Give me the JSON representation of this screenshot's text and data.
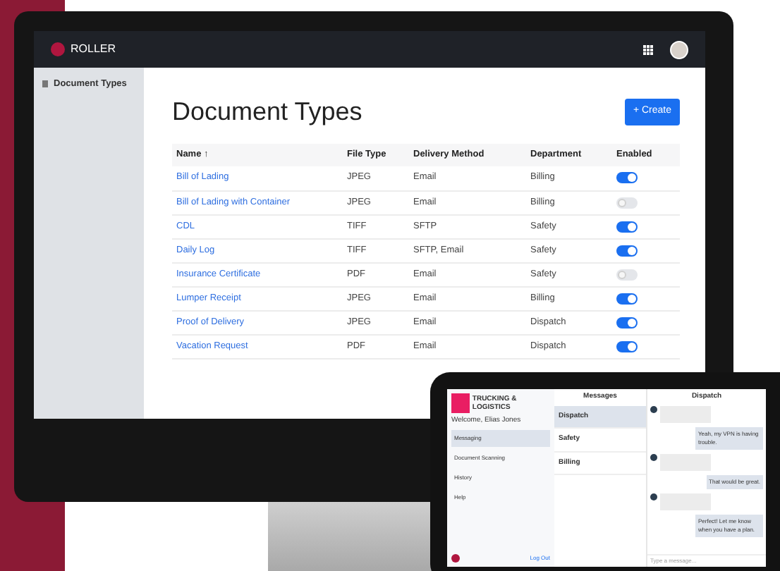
{
  "brand": "ROLLER",
  "sidebar": {
    "items": [
      {
        "label": "Document Types",
        "selected": true
      }
    ]
  },
  "page": {
    "title": "Document Types",
    "create_button": "+ Create"
  },
  "table": {
    "columns": [
      "Name ↑",
      "File Type",
      "Delivery Method",
      "Department",
      "Enabled"
    ],
    "rows": [
      {
        "name": "Bill of Lading",
        "file_type": "JPEG",
        "delivery_method": "Email",
        "department": "Billing",
        "enabled": true
      },
      {
        "name": "Bill of Lading with Container",
        "file_type": "JPEG",
        "delivery_method": "Email",
        "department": "Billing",
        "enabled": false
      },
      {
        "name": "CDL",
        "file_type": "TIFF",
        "delivery_method": "SFTP",
        "department": "Safety",
        "enabled": true
      },
      {
        "name": "Daily Log",
        "file_type": "TIFF",
        "delivery_method": "SFTP, Email",
        "department": "Safety",
        "enabled": true
      },
      {
        "name": "Insurance Certificate",
        "file_type": "PDF",
        "delivery_method": "Email",
        "department": "Safety",
        "enabled": false
      },
      {
        "name": "Lumper Receipt",
        "file_type": "JPEG",
        "delivery_method": "Email",
        "department": "Billing",
        "enabled": true
      },
      {
        "name": "Proof of Delivery",
        "file_type": "JPEG",
        "delivery_method": "Email",
        "department": "Dispatch",
        "enabled": true
      },
      {
        "name": "Vacation Request",
        "file_type": "PDF",
        "delivery_method": "Email",
        "department": "Dispatch",
        "enabled": true
      }
    ]
  },
  "tablet": {
    "company": "TRUCKING & LOGISTICS",
    "welcome": "Welcome, Elias Jones",
    "nav": [
      {
        "label": "Messaging",
        "selected": true
      },
      {
        "label": "Document Scanning",
        "selected": false
      },
      {
        "label": "History",
        "selected": false
      },
      {
        "label": "Help",
        "selected": false
      }
    ],
    "logout": "Log Out",
    "messages_title": "Messages",
    "chat_title": "Dispatch",
    "threads": [
      {
        "name": "Dispatch",
        "selected": true
      },
      {
        "name": "Safety",
        "selected": false
      },
      {
        "name": "Billing",
        "selected": false
      }
    ],
    "chat": [
      {
        "kind": "received"
      },
      {
        "kind": "sent",
        "text": "Yeah, my VPN is having trouble."
      },
      {
        "kind": "received"
      },
      {
        "kind": "sent",
        "text": "That would be great."
      },
      {
        "kind": "received"
      },
      {
        "kind": "sent",
        "text": "Perfect! Let me know when you have a plan."
      }
    ],
    "input_placeholder": "Type a message..."
  }
}
